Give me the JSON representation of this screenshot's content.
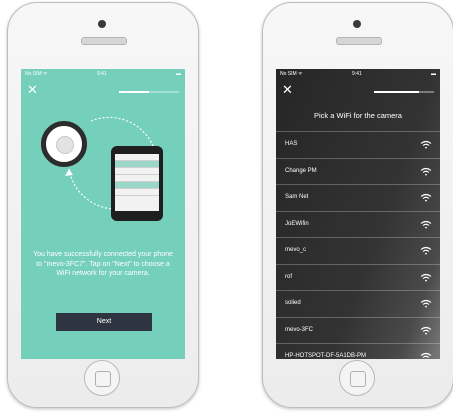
{
  "left_screen": {
    "status": {
      "carrier": "No SIM ᯤ",
      "time": "9:41",
      "battery": "▬"
    },
    "step": "",
    "progress": 0.5,
    "close_glyph": "✕",
    "message": "You have successfully connected your phone to \"mevo-3FC7\". Tap on \"Next\" to choose a WiFi network for your camera.",
    "next_label": "Next",
    "background_color": "#74cfbb"
  },
  "right_screen": {
    "status": {
      "carrier": "No SIM ᯤ",
      "time": "9:41",
      "battery": "▬"
    },
    "step": "",
    "progress": 0.75,
    "close_glyph": "✕",
    "title": "Pick a WiFi for the camera",
    "networks": [
      {
        "name": "HAS"
      },
      {
        "name": "Change PM"
      },
      {
        "name": "Sam Net"
      },
      {
        "name": "JoEWifin"
      },
      {
        "name": "mevo_c"
      },
      {
        "name": "rof"
      },
      {
        "name": "solied"
      },
      {
        "name": "mevo-3FC"
      },
      {
        "name": "HP-HOTSPOT-DF-5A1DB-PM"
      }
    ],
    "wifi_icon": "wifi-icon"
  }
}
